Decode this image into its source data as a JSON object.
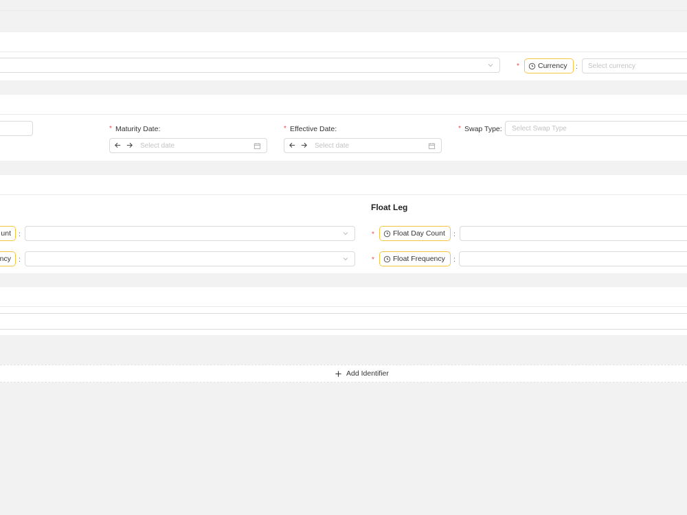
{
  "top_section": {
    "currency": {
      "label": "Currency",
      "placeholder": "Select currency"
    }
  },
  "dates_section": {
    "maturity": {
      "label": "Maturity Date",
      "placeholder": "Select date"
    },
    "effective": {
      "label": "Effective Date",
      "placeholder": "Select date"
    },
    "swap_type": {
      "label": "Swap Type",
      "placeholder": "Select Swap Type"
    }
  },
  "legs_section": {
    "fixed_day_count_tag": "unt",
    "fixed_frequency_tag": "ncy",
    "float_leg": {
      "heading": "Float Leg",
      "day_count_label": "Float Day Count",
      "frequency_label": "Float Frequency"
    }
  },
  "identifiers": {
    "add_label": "Add Identifier"
  },
  "colors": {
    "tag_border": "#f5c542",
    "required": "#e84a4a"
  }
}
